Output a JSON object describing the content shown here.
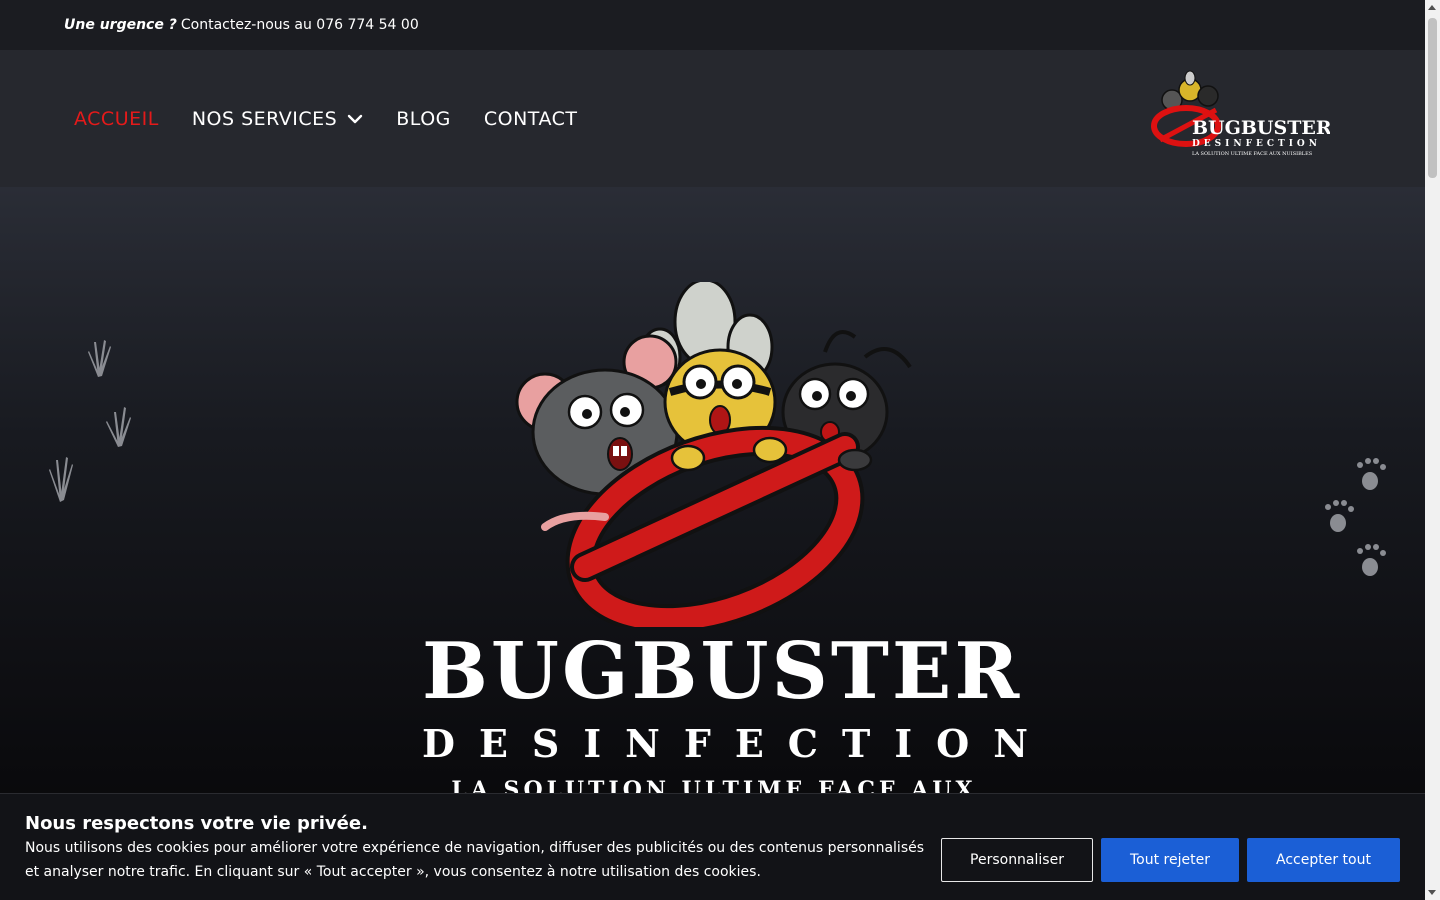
{
  "topbar": {
    "urgent_label": "Une urgence ?",
    "contact_text": "Contactez-nous au 076 774 54 00"
  },
  "nav": {
    "items": [
      {
        "label": "ACCUEIL",
        "active": true
      },
      {
        "label": "NOS SERVICES",
        "has_dropdown": true
      },
      {
        "label": "BLOG"
      },
      {
        "label": "CONTACT"
      }
    ]
  },
  "logo": {
    "title": "BUGBUSTER",
    "subtitle": "DESINFECTION",
    "tagline": "LA SOLUTION ULTIME FACE AUX NUISIBLES"
  },
  "hero": {
    "title": "BUGBUSTER",
    "subtitle": "DESINFECTION",
    "tagline": "LA SOLUTION ULTIME FACE AUX NUISIBLES"
  },
  "cookie_banner": {
    "title": "Nous respectons votre vie privée.",
    "text": "Nous utilisons des cookies pour améliorer votre expérience de navigation, diffuser des publicités ou des contenus personnalisés et analyser notre trafic. En cliquant sur « Tout accepter », vous consentez à notre utilisation des cookies.",
    "customize_label": "Personnaliser",
    "reject_label": "Tout rejeter",
    "accept_label": "Accepter tout"
  },
  "colors": {
    "accent_red": "#e41a1a",
    "button_blue": "#1b5fd6",
    "header_bg": "#26282e",
    "topbar_bg": "#1b1c21"
  }
}
